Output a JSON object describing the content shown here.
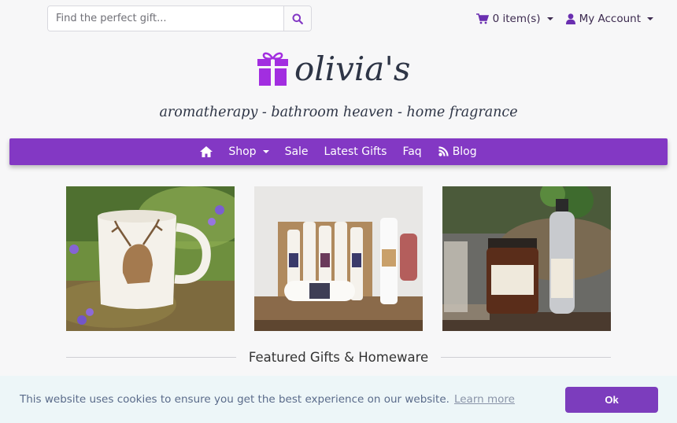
{
  "header": {
    "search": {
      "placeholder": "Find the perfect gift...",
      "value": ""
    },
    "cart_label": "0 item(s)",
    "account_label": "My Account"
  },
  "logo": {
    "brand": "olivia's",
    "tagline": "aromatherapy - bathroom heaven - home fragrance"
  },
  "nav": {
    "items": [
      {
        "label": ""
      },
      {
        "label": "Shop"
      },
      {
        "label": "Sale"
      },
      {
        "label": "Latest Gifts"
      },
      {
        "label": "Faq"
      },
      {
        "label": "Blog"
      }
    ]
  },
  "featured": {
    "title": "Featured Gifts & Homeware"
  },
  "tiles": [
    {
      "icon": "stag-mug-photo"
    },
    {
      "icon": "candles-photo"
    },
    {
      "icon": "aromatherapy-bottles-photo"
    }
  ],
  "cookie": {
    "message": "This website uses cookies to ensure you get the best experience on our website.",
    "learn_more": "Learn more",
    "ok_label": "Ok"
  },
  "colors": {
    "brand_purple": "#8338c4",
    "gift_icon": "#a22ee0",
    "cookie_button": "#7c3dbd",
    "cookie_bg": "#edf6f8"
  }
}
